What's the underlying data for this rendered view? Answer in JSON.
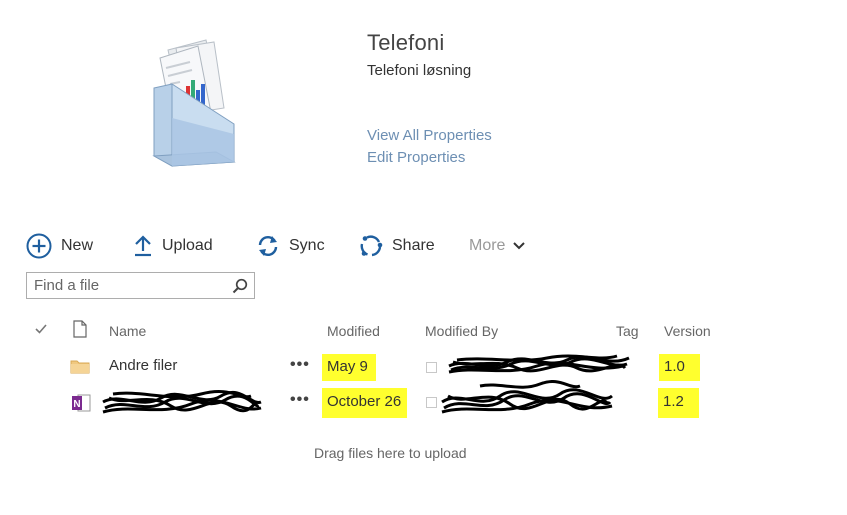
{
  "site": {
    "title": "Telefoni",
    "subtitle": "Telefoni løsning",
    "view_all_properties": "View All Properties",
    "edit_properties": "Edit Properties"
  },
  "toolbar": {
    "new_label": "New",
    "upload_label": "Upload",
    "sync_label": "Sync",
    "share_label": "Share",
    "more_label": "More"
  },
  "search": {
    "placeholder": "Find a file"
  },
  "columns": {
    "name": "Name",
    "modified": "Modified",
    "modified_by": "Modified By",
    "tag": "Tag",
    "version": "Version"
  },
  "rows": [
    {
      "name": "Andre filer",
      "modified": "May 9",
      "version": "1.0",
      "type": "folder"
    },
    {
      "name": "",
      "modified": "October 26",
      "version": "1.2",
      "type": "onenote"
    }
  ],
  "drop_hint": "Drag files here to upload",
  "colors": {
    "link": "#6d8fb3",
    "accent_blue": "#1f5f9f",
    "highlight": "#ffff2e",
    "folder": "#f0c880",
    "onenote": "#7b2a8f"
  },
  "icons": [
    "document-library-icon",
    "plus-circle-icon",
    "upload-arrow-icon",
    "sync-icon",
    "share-icon",
    "chevron-down-icon",
    "search-icon",
    "checkmark-icon",
    "file-icon",
    "folder-icon",
    "onenote-icon",
    "ellipsis-icon"
  ]
}
